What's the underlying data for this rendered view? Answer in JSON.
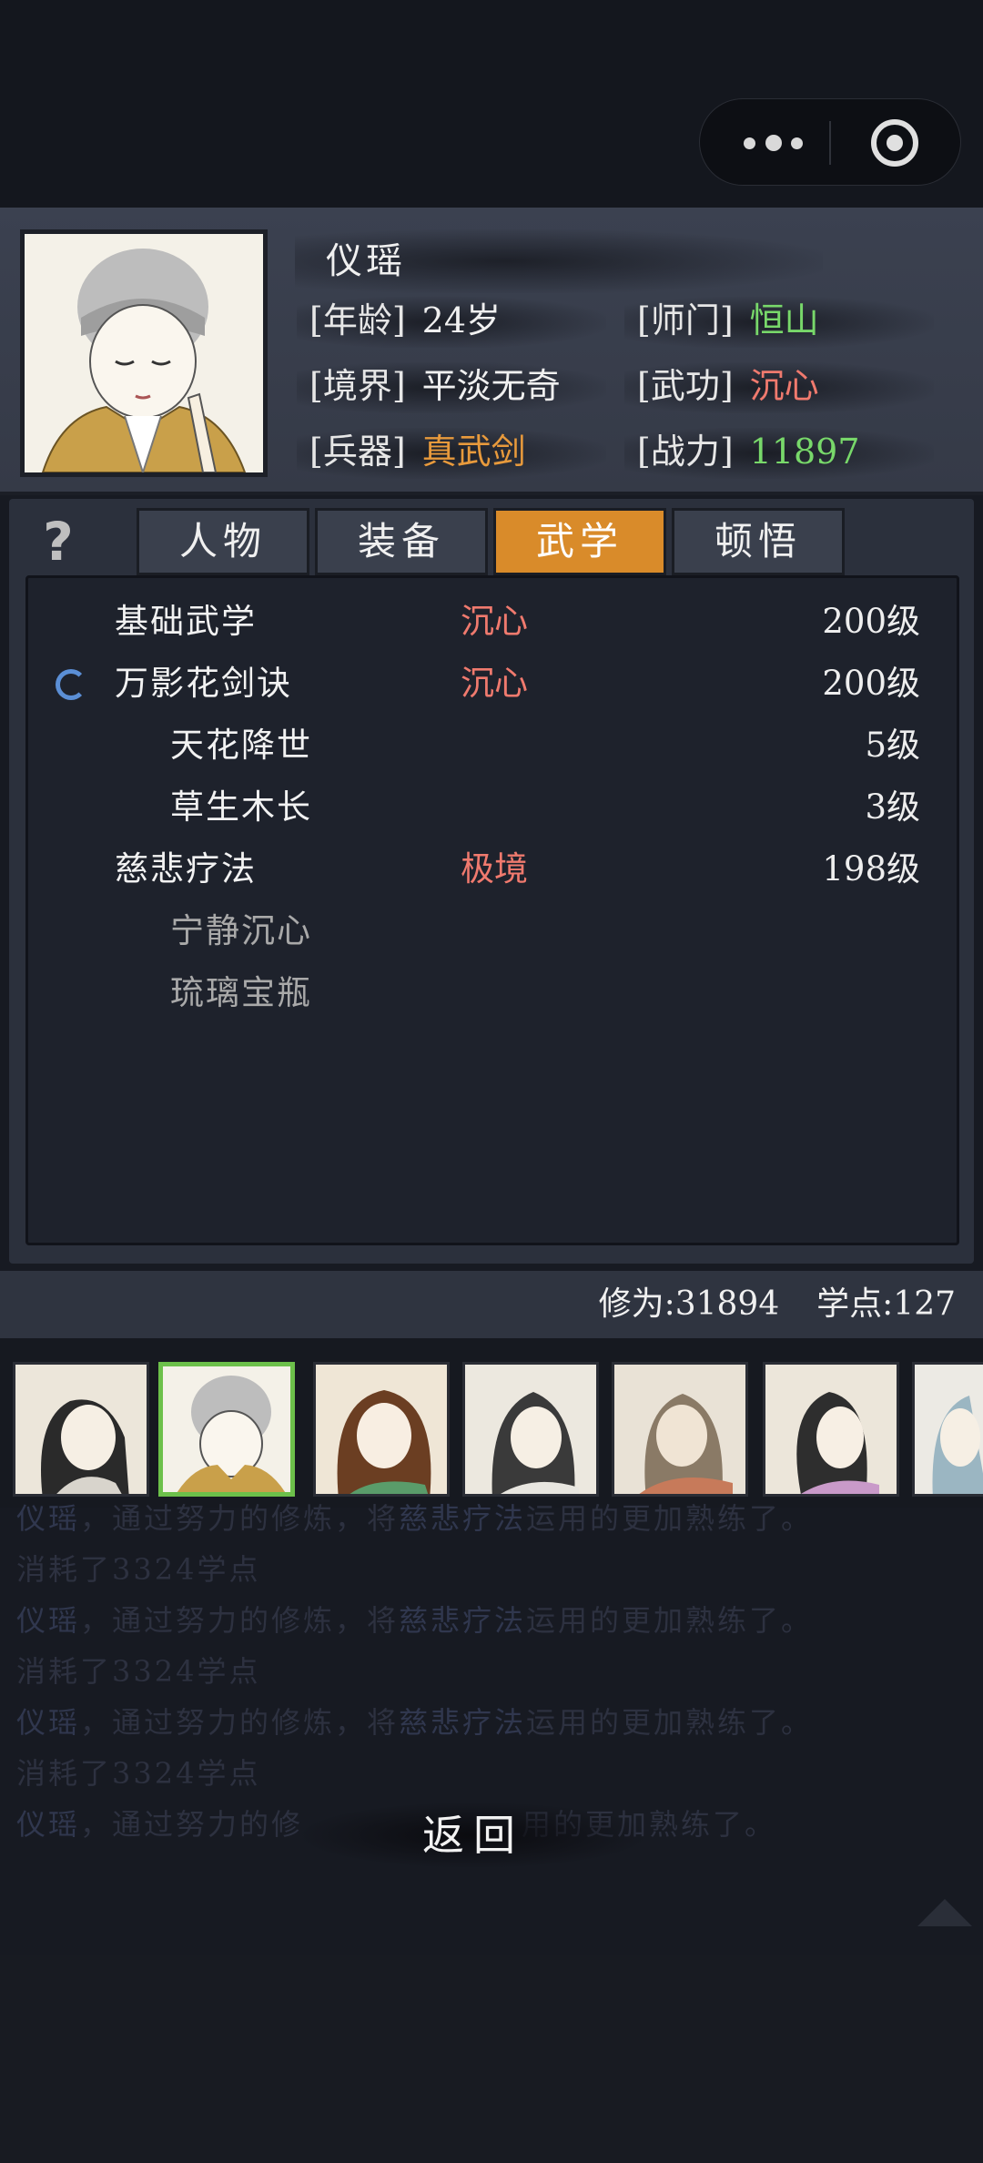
{
  "character": {
    "name": "仪瑶",
    "stats": [
      {
        "label": "[年龄]",
        "value": "24岁",
        "color": "white"
      },
      {
        "label": "[师门]",
        "value": "恒山",
        "color": "green"
      },
      {
        "label": "[境界]",
        "value": "平淡无奇",
        "color": "white"
      },
      {
        "label": "[武功]",
        "value": "沉心",
        "color": "red"
      },
      {
        "label": "[兵器]",
        "value": "真武剑",
        "color": "orange"
      },
      {
        "label": "[战力]",
        "value": "11897",
        "color": "green"
      }
    ]
  },
  "help_icon": "?",
  "tabs": [
    {
      "label": "人物",
      "active": false
    },
    {
      "label": "装备",
      "active": false
    },
    {
      "label": "武学",
      "active": true
    },
    {
      "label": "顿悟",
      "active": false
    }
  ],
  "martial_arts": [
    {
      "name": "基础武学",
      "state": "沉心",
      "level": "200级",
      "indent": false,
      "dim": false,
      "spinner": false
    },
    {
      "name": "万影花剑诀",
      "state": "沉心",
      "level": "200级",
      "indent": false,
      "dim": false,
      "spinner": true
    },
    {
      "name": "天花降世",
      "state": "",
      "level": "5级",
      "indent": true,
      "dim": false,
      "spinner": false
    },
    {
      "name": "草生木长",
      "state": "",
      "level": "3级",
      "indent": true,
      "dim": false,
      "spinner": false
    },
    {
      "name": "慈悲疗法",
      "state": "极境",
      "level": "198级",
      "indent": false,
      "dim": false,
      "spinner": false
    },
    {
      "name": "宁静沉心",
      "state": "",
      "level": "",
      "indent": true,
      "dim": true,
      "spinner": false
    },
    {
      "name": "琉璃宝瓶",
      "state": "",
      "level": "",
      "indent": true,
      "dim": true,
      "spinner": false
    }
  ],
  "points": {
    "cultivation": "修为:31894",
    "study": "学点:127"
  },
  "log": [
    {
      "a": "仪瑶",
      "b": "，通过努力的修炼，将",
      "c": "慈悲疗法",
      "d": "运用的更加熟练了。"
    },
    {
      "a": "",
      "b": "消耗了3324学点",
      "c": "",
      "d": ""
    },
    {
      "a": "仪瑶",
      "b": "，通过努力的修炼，将",
      "c": "慈悲疗法",
      "d": "运用的更加熟练了。"
    },
    {
      "a": "",
      "b": "消耗了3324学点",
      "c": "",
      "d": ""
    },
    {
      "a": "仪瑶",
      "b": "，通过努力的修炼，将",
      "c": "慈悲疗法",
      "d": "运用的更加熟练了。"
    },
    {
      "a": "",
      "b": "消耗了3324学点",
      "c": "",
      "d": ""
    },
    {
      "a": "仪瑶",
      "b": "，通过努力的修",
      "c": "",
      "d": "用的更加熟练了。"
    }
  ],
  "back_label": "返回",
  "colors": {
    "accent_tab": "#d98b2a",
    "selected_border": "#6cc04a",
    "green": "#78d86a",
    "red": "#f07a6e",
    "orange": "#e89a3c"
  }
}
